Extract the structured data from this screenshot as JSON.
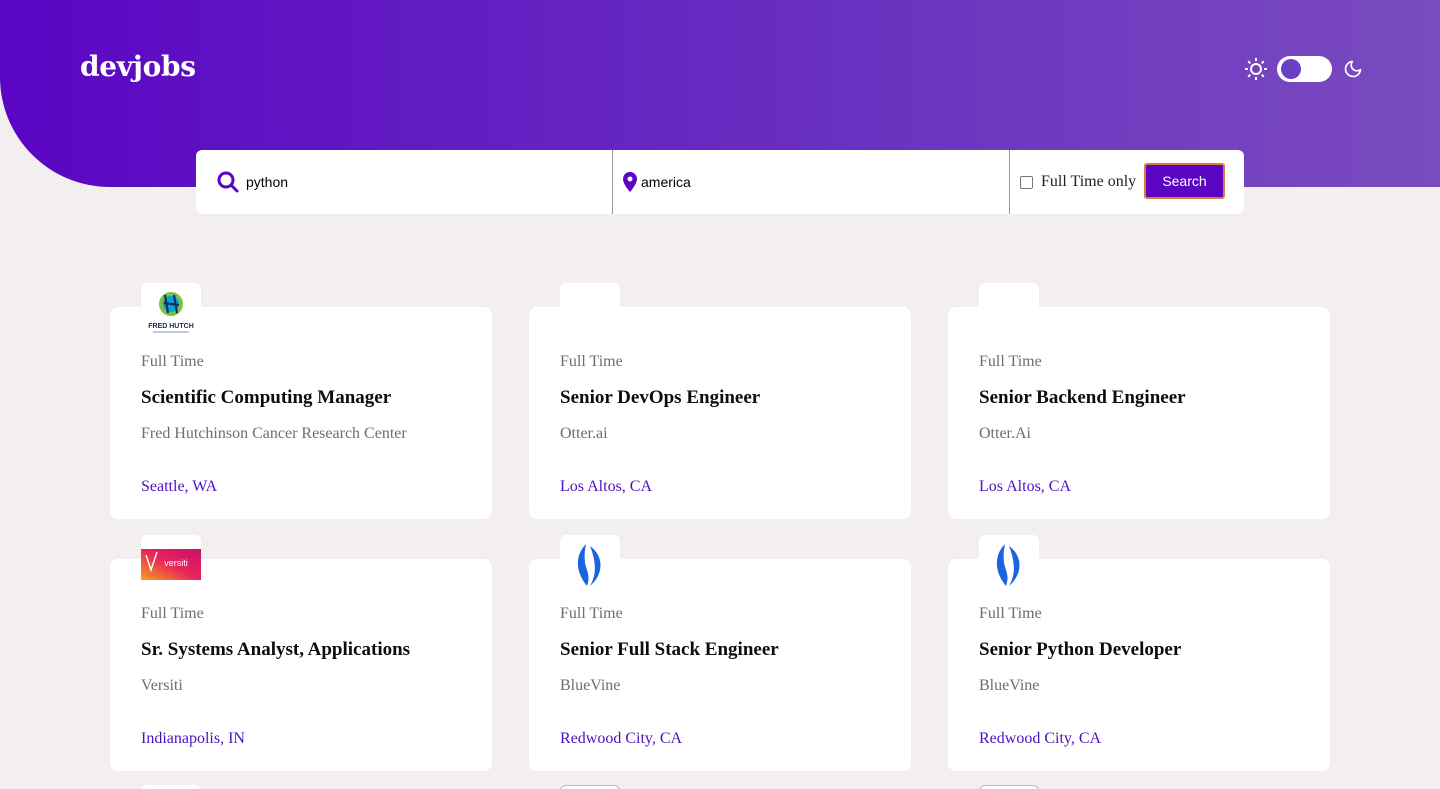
{
  "header": {
    "logo": "devjobs",
    "theme_toggle": {
      "mode": "light",
      "sun_icon": "sun-icon",
      "moon_icon": "moon-icon"
    }
  },
  "search": {
    "query_value": "python",
    "query_placeholder": "",
    "location_value": "america",
    "location_placeholder": "",
    "full_time_label": "Full Time only",
    "full_time_checked": false,
    "button_label": "Search"
  },
  "colors": {
    "accent": "#5a05c4",
    "location_text": "#4d11c0",
    "muted_text": "#6e6e6e",
    "page_bg": "#f2efee"
  },
  "jobs": [
    {
      "logo": "fred-hutch-logo",
      "type": "Full Time",
      "title": "Scientific Computing Manager",
      "company": "Fred Hutchinson Cancer Research Center",
      "location": "Seattle, WA"
    },
    {
      "logo": "otter-logo",
      "type": "Full Time",
      "title": "Senior DevOps Engineer",
      "company": "Otter.ai",
      "location": "Los Altos, CA"
    },
    {
      "logo": "otter-logo",
      "type": "Full Time",
      "title": "Senior Backend Engineer",
      "company": "Otter.Ai",
      "location": "Los Altos, CA"
    },
    {
      "logo": "versiti-logo",
      "type": "Full Time",
      "title": "Sr. Systems Analyst, Applications",
      "company": "Versiti",
      "location": "Indianapolis, IN"
    },
    {
      "logo": "bluevine-logo",
      "type": "Full Time",
      "title": "Senior Full Stack Engineer",
      "company": "BlueVine",
      "location": "Redwood City, CA"
    },
    {
      "logo": "bluevine-logo",
      "type": "Full Time",
      "title": "Senior Python Developer",
      "company": "BlueVine",
      "location": "Redwood City, CA"
    }
  ],
  "logo_text": {
    "fred_hutch": "FRED HUTCH",
    "versiti": "versiti"
  }
}
